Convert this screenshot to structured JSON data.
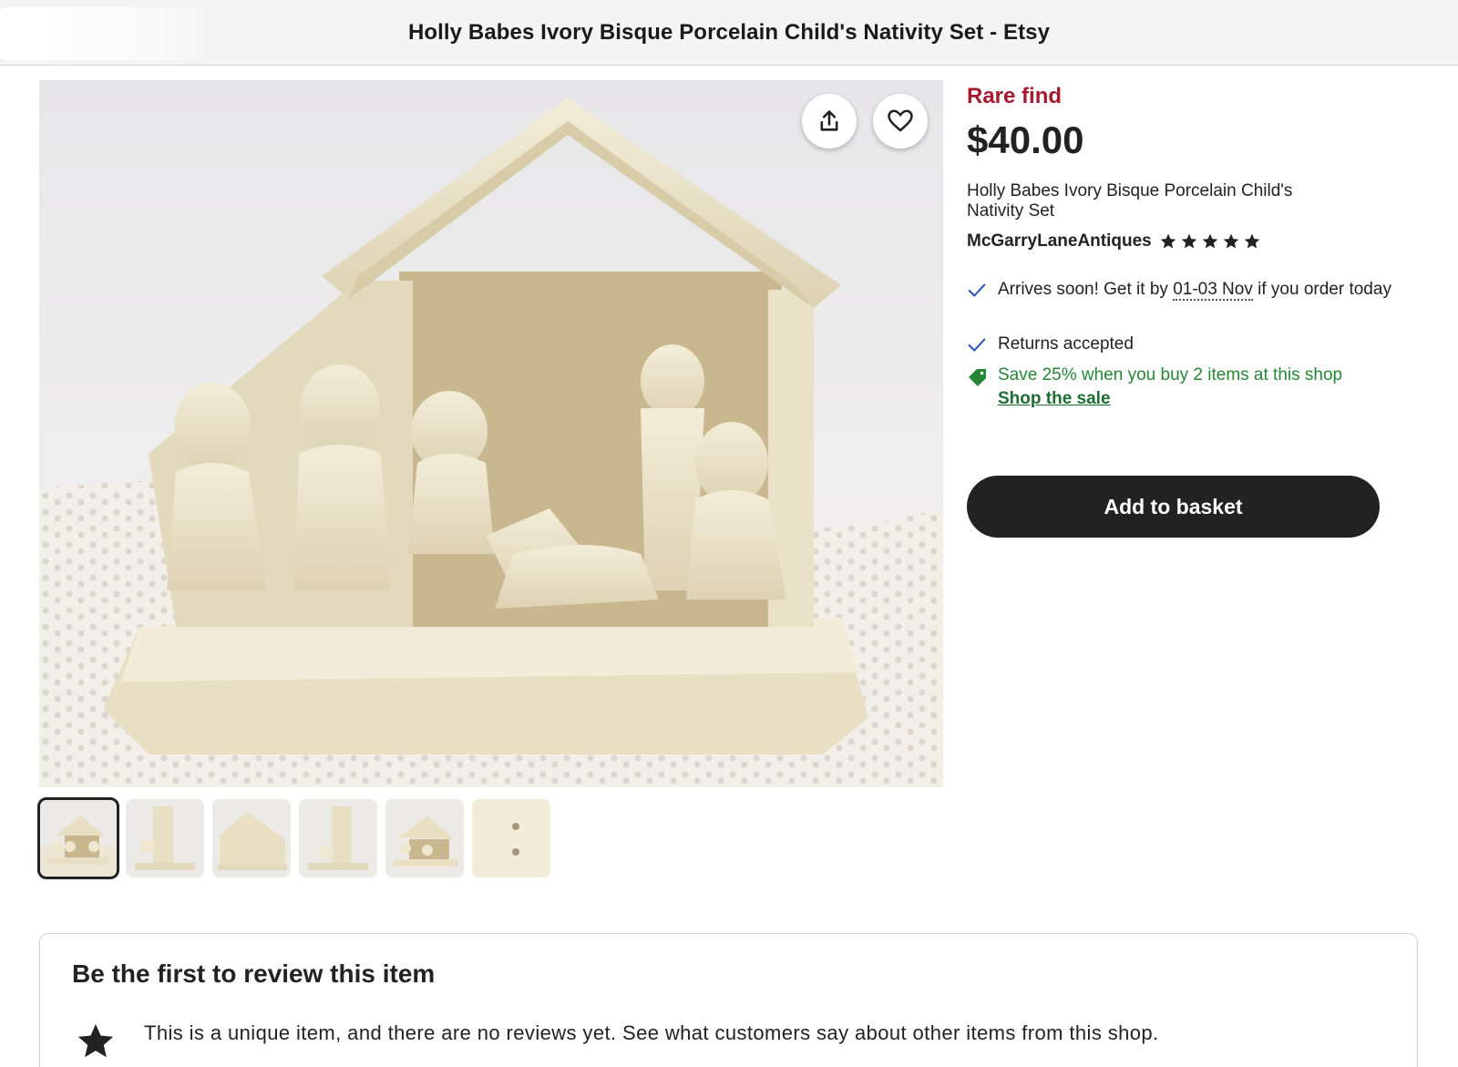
{
  "window": {
    "title": "Holly Babes Ivory Bisque Porcelain Child's Nativity Set - Etsy"
  },
  "gallery": {
    "main_image_icon": "nativity-photo",
    "share_icon": "share-icon",
    "favorite_icon": "heart-icon",
    "thumbnails": [
      {
        "icon": "nativity-front-thumb",
        "active": true
      },
      {
        "icon": "nativity-side-thumb",
        "active": false
      },
      {
        "icon": "nativity-back-thumb",
        "active": false
      },
      {
        "icon": "nativity-side2-thumb",
        "active": false
      },
      {
        "icon": "nativity-angle-thumb",
        "active": false
      },
      {
        "icon": "nativity-base-thumb",
        "active": false
      }
    ]
  },
  "listing": {
    "badge": "Rare find",
    "price": "$40.00",
    "title": "Holly Babes Ivory Bisque Porcelain Child's Nativity Set",
    "shop_name": "McGarryLaneAntiques",
    "rating_stars": 5
  },
  "perks": {
    "arrival_prefix": "Arrives soon! Get it by ",
    "arrival_date": "01-03 Nov",
    "arrival_suffix": " if you order today",
    "returns": "Returns accepted",
    "sale_text": "Save 25% when you buy 2 items at this shop",
    "sale_link": "Shop the sale"
  },
  "actions": {
    "add_to_basket": "Add to basket"
  },
  "reviews": {
    "heading": "Be the first to review this item",
    "message": "This is a unique item, and there are no reviews yet. See what customers say about other items from this shop."
  },
  "colors": {
    "rare_find": "#a61a2e",
    "sale_green": "#258635",
    "check_blue": "#2a52be",
    "button_dark": "#222222"
  }
}
